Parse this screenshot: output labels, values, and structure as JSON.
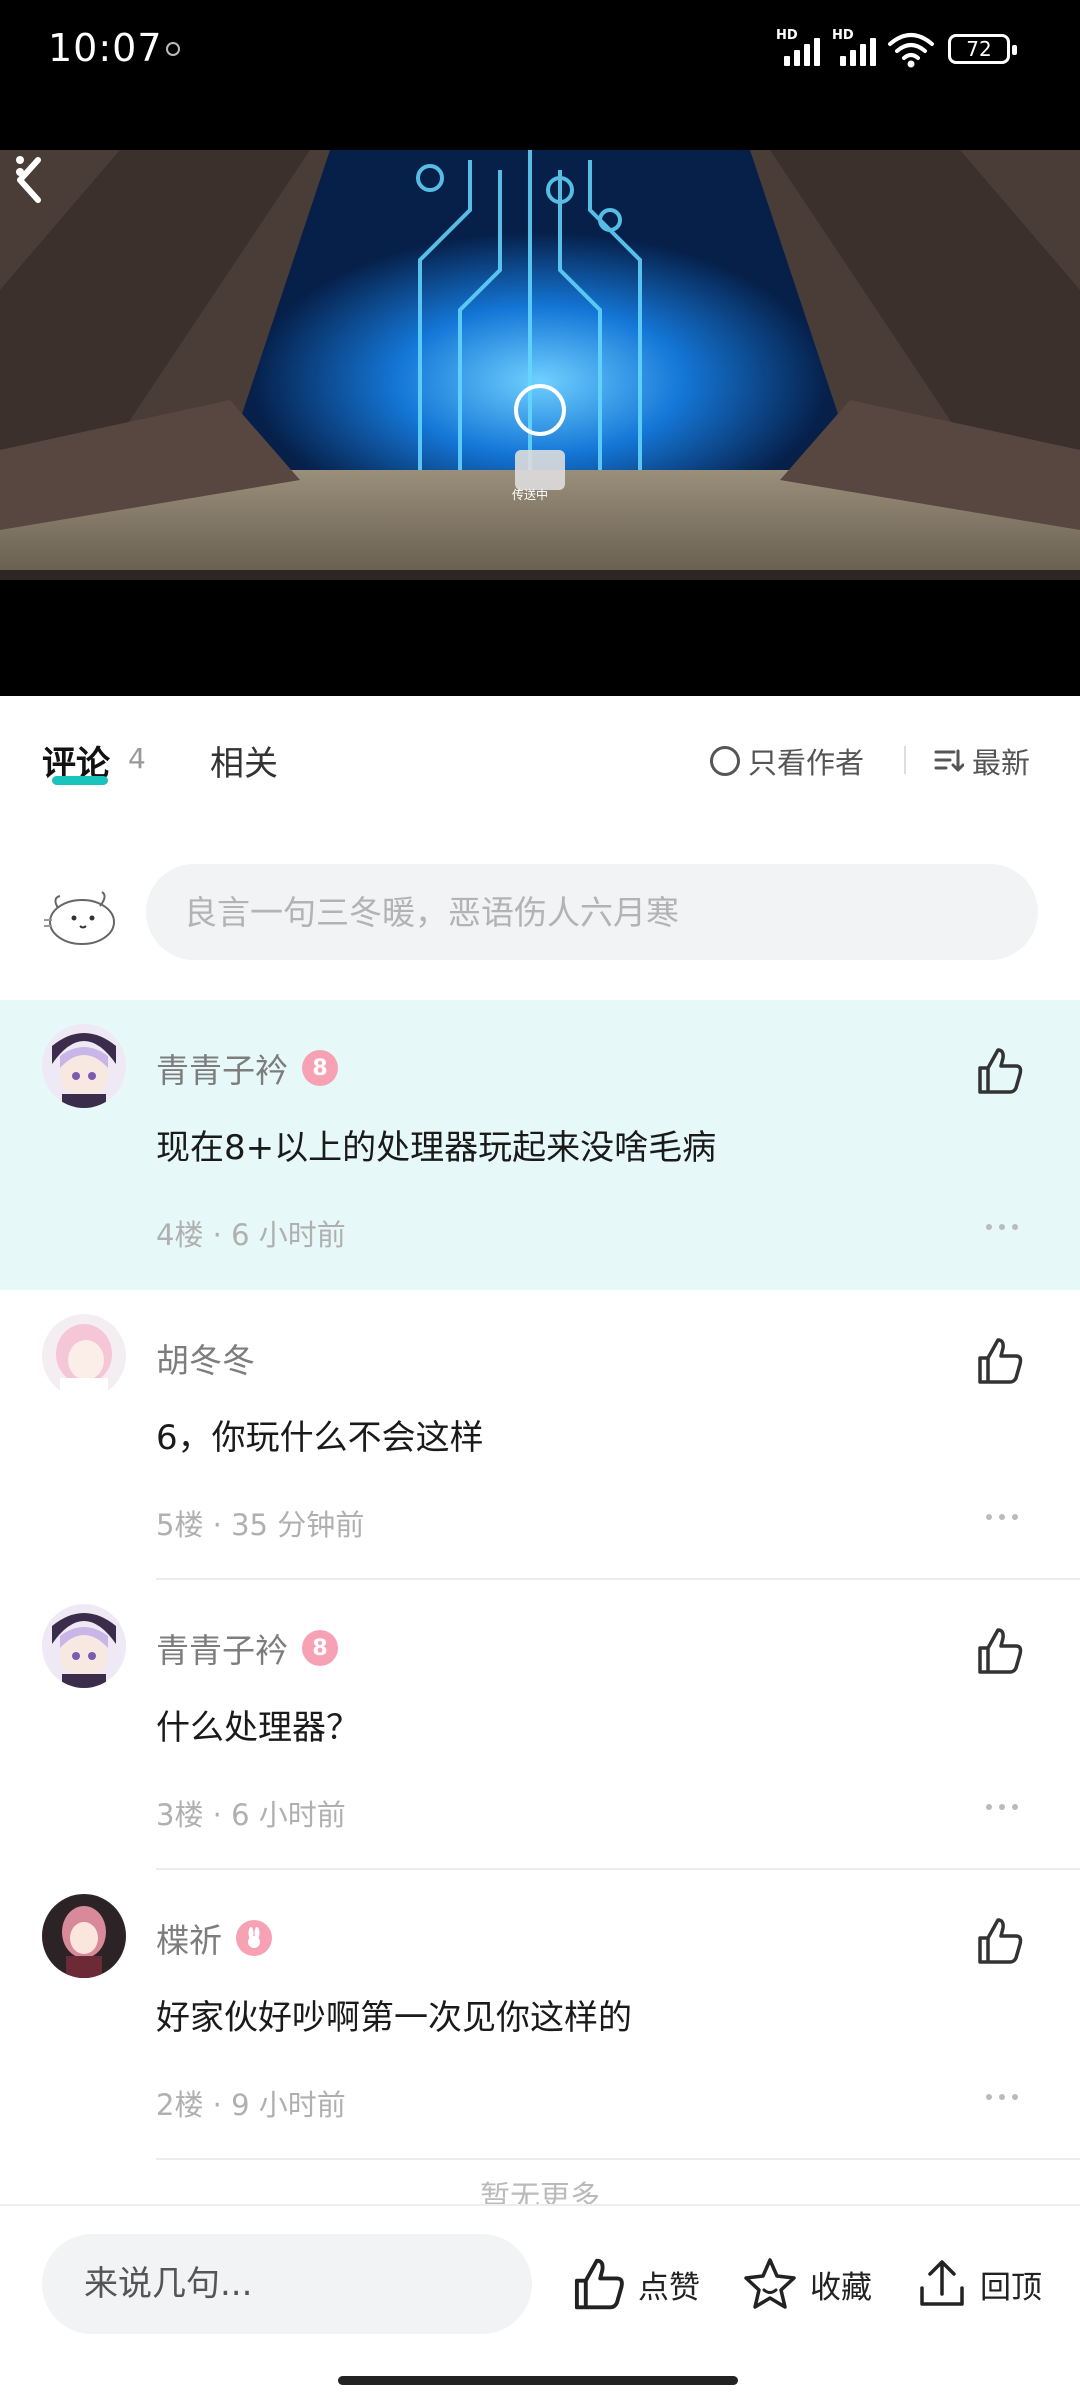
{
  "status_bar": {
    "time": "10:07",
    "network_label_1": "HD",
    "network_label_2": "HD",
    "battery": "72"
  },
  "video": {
    "overlay_text": "传送中",
    "back_icon": "chevron-left-icon",
    "more_icon": "more-vertical-icon"
  },
  "tabs": {
    "comments_label": "评论",
    "comments_count": "4",
    "related_label": "相关",
    "author_only_label": "只看作者",
    "sort_label": "最新"
  },
  "compose": {
    "placeholder": "良言一句三冬暖，恶语伤人六月寒"
  },
  "comments": [
    {
      "name": "青青子衿",
      "badge": "8",
      "text": "现在8+以上的处理器玩起来没啥毛病",
      "meta": "4楼 · 6 小时前"
    },
    {
      "name": "胡冬冬",
      "badge": "",
      "text": "6，你玩什么不会这样",
      "meta": "5楼 · 35 分钟前"
    },
    {
      "name": "青青子衿",
      "badge": "8",
      "text": "什么处理器？",
      "meta": "3楼 · 6 小时前"
    },
    {
      "name": "楪祈",
      "badge": "",
      "text": "好家伙好吵啊第一次见你这样的",
      "meta": "2楼 · 9 小时前"
    }
  ],
  "no_more": "暂无更多",
  "bottom_bar": {
    "reply_placeholder": "来说几句...",
    "like_label": "点赞",
    "favorite_label": "收藏",
    "top_label": "回顶"
  },
  "colors": {
    "accent": "#19c4bd",
    "highlight_bg": "#e6f8f7",
    "badge_pink": "#f7a1b4"
  }
}
